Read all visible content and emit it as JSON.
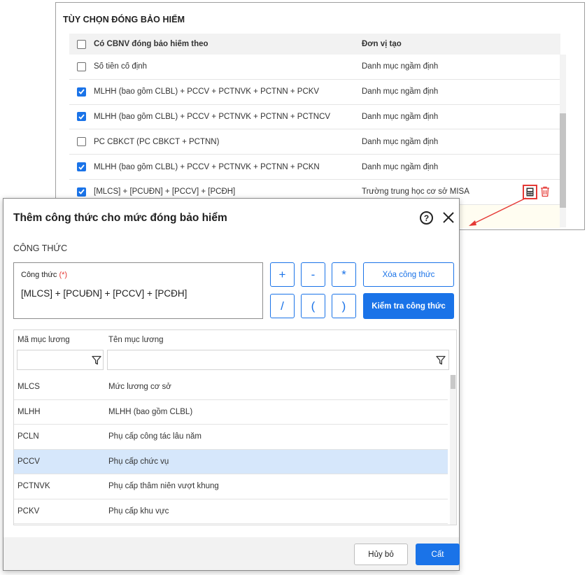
{
  "background_panel": {
    "title": "TÙY CHỌN ĐÓNG BẢO HIỂM",
    "header": {
      "name": "Có CBNV đóng bảo hiểm theo",
      "unit": "Đơn vị tạo",
      "checked": false
    },
    "rows": [
      {
        "name": "Số tiền cố định",
        "unit": "Danh mục ngầm định",
        "checked": false
      },
      {
        "name": "MLHH (bao gồm CLBL) + PCCV + PCTNVK + PCTNN + PCKV",
        "unit": "Danh mục ngầm định",
        "checked": true
      },
      {
        "name": "MLHH (bao gồm CLBL) + PCCV + PCTNVK + PCTNN + PCTNCV",
        "unit": "Danh mục ngầm định",
        "checked": true
      },
      {
        "name": "PC CBKCT (PC CBKCT + PCTNN)",
        "unit": "Danh mục ngầm định",
        "checked": false
      },
      {
        "name": "MLHH (bao gồm CLBL) + PCCV + PCTNVK + PCTNN + PCKN",
        "unit": "Danh mục ngầm định",
        "checked": true
      },
      {
        "name": "[MLCS] + [PCUĐN] + [PCCV] + [PCĐH]",
        "unit": "Trường trung học cơ sở MISA",
        "checked": true
      }
    ]
  },
  "dialog": {
    "title": "Thêm công thức cho mức đóng bảo hiểm",
    "help_glyph": "?",
    "section_label": "CÔNG THỨC",
    "formula_label": "Công thức",
    "required_mark": "(*)",
    "formula_value": "[MLCS] + [PCUĐN] + [PCCV] + [PCĐH]",
    "operators": [
      "+",
      "-",
      "*",
      "/",
      "(",
      ")"
    ],
    "clear_button": "Xóa công thức",
    "check_button": "Kiểm tra công thức",
    "grid": {
      "columns": [
        "Mã mục lương",
        "Tên mục lương"
      ],
      "rows": [
        {
          "code": "MLCS",
          "name": "Mức lương cơ sở",
          "selected": false
        },
        {
          "code": "MLHH",
          "name": "MLHH (bao gồm CLBL)",
          "selected": false
        },
        {
          "code": "PCLN",
          "name": "Phụ cấp công tác lâu năm",
          "selected": false
        },
        {
          "code": "PCCV",
          "name": "Phụ cấp chức vụ",
          "selected": true
        },
        {
          "code": "PCTNVK",
          "name": "Phụ cấp thâm niên vượt khung",
          "selected": false
        },
        {
          "code": "PCKV",
          "name": "Phụ cấp khu vực",
          "selected": false
        }
      ]
    },
    "cancel_button": "Hủy bỏ",
    "save_button": "Cất"
  },
  "colors": {
    "primary": "#1a73e8",
    "danger": "#e53935",
    "selected_row": "#d6e7fb"
  },
  "icons": [
    "checkbox-icon",
    "calculator-icon",
    "trash-icon",
    "help-icon",
    "close-icon",
    "filter-icon"
  ]
}
